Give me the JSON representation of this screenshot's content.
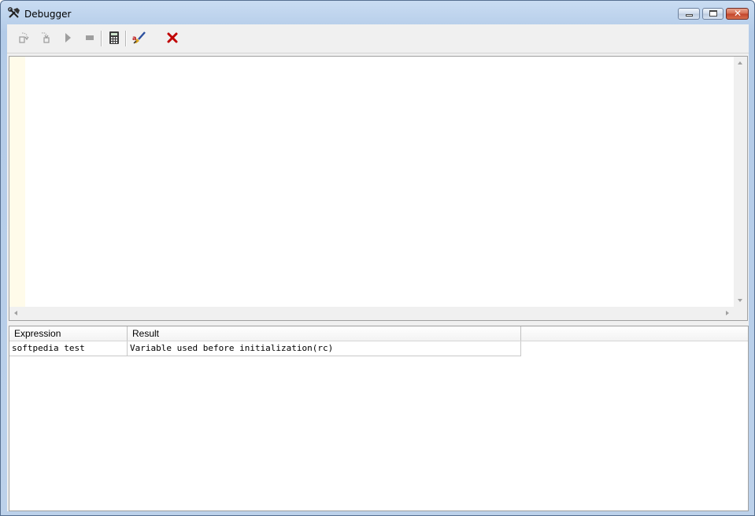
{
  "window": {
    "title": "Debugger",
    "close_glyph": "✕"
  },
  "toolbar": {
    "buttons": [
      {
        "name": "step-into",
        "icon": "step-into-icon",
        "enabled": false
      },
      {
        "name": "step-over",
        "icon": "step-over-icon",
        "enabled": false
      },
      {
        "name": "run",
        "icon": "play-icon",
        "enabled": false
      },
      {
        "name": "stop",
        "icon": "stop-icon",
        "enabled": false
      },
      {
        "name": "calculator",
        "icon": "calculator-icon",
        "enabled": true
      },
      {
        "name": "edit-watch",
        "icon": "edit-brush-icon",
        "enabled": true
      },
      {
        "name": "close",
        "icon": "red-x-icon",
        "enabled": true
      }
    ]
  },
  "watch": {
    "columns": [
      "Expression",
      "Result"
    ],
    "rows": [
      {
        "expression": "softpedia test",
        "result": "Variable used before initialization(rc)"
      }
    ]
  },
  "colors": {
    "gutter": "#fffbea",
    "close_x": "#c00000",
    "title_bar": "#c9dcf2"
  }
}
